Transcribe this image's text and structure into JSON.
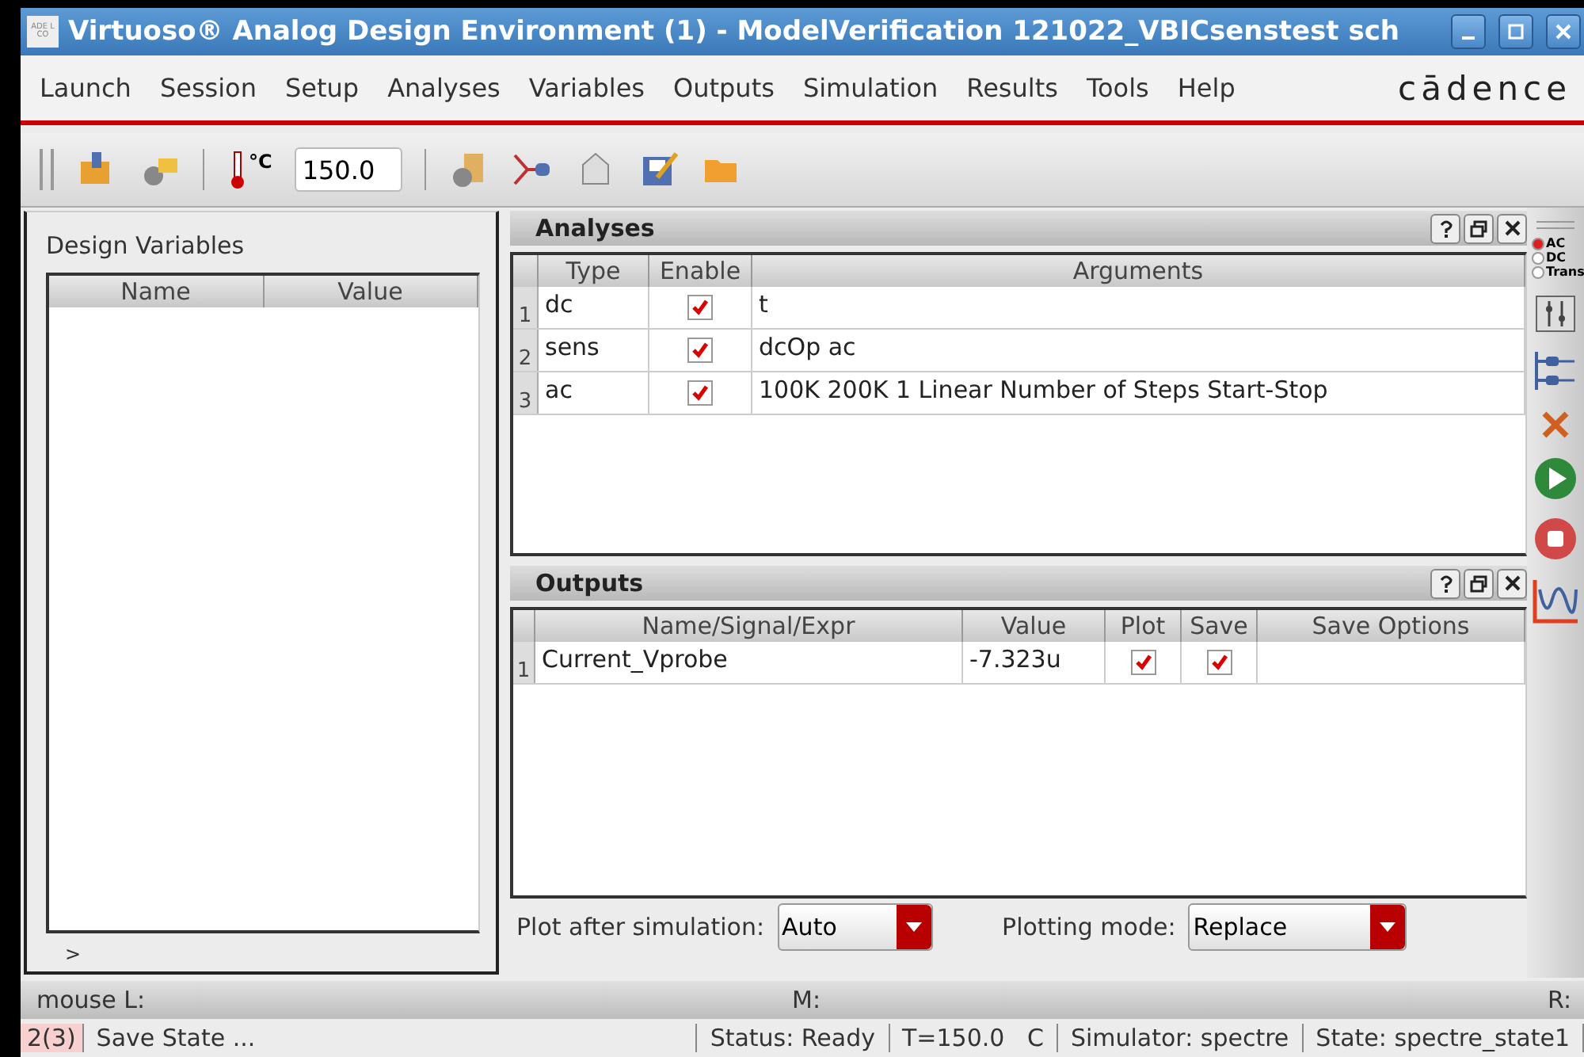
{
  "window": {
    "title": "Virtuoso® Analog Design Environment (1) - ModelVerification 121022_VBICsenstest sch",
    "logo_text": "ADE L CO"
  },
  "menu": [
    "Launch",
    "Session",
    "Setup",
    "Analyses",
    "Variables",
    "Outputs",
    "Simulation",
    "Results",
    "Tools",
    "Help"
  ],
  "brand": "cādence",
  "toolbar": {
    "temperature_unit": "°C",
    "temperature": "150.0"
  },
  "design_variables": {
    "title": "Design Variables",
    "columns": [
      "Name",
      "Value"
    ],
    "prompt": ">"
  },
  "analyses": {
    "title": "Analyses",
    "columns": [
      "Type",
      "Enable",
      "Arguments"
    ],
    "rows": [
      {
        "index": "1",
        "type": "dc",
        "enabled": true,
        "arguments": "t"
      },
      {
        "index": "2",
        "type": "sens",
        "enabled": true,
        "arguments": "dcOp ac"
      },
      {
        "index": "3",
        "type": "ac",
        "enabled": true,
        "arguments": "100K 200K 1 Linear Number of Steps Start-Stop"
      }
    ]
  },
  "outputs": {
    "title": "Outputs",
    "columns": [
      "Name/Signal/Expr",
      "Value",
      "Plot",
      "Save",
      "Save Options"
    ],
    "rows": [
      {
        "index": "1",
        "name": "Current_Vprobe",
        "value": "-7.323u",
        "plot": true,
        "save": true
      }
    ],
    "plot_after_label": "Plot after simulation:",
    "plot_after": "Auto",
    "plotting_mode_label": "Plotting mode:",
    "plotting_mode": "Replace"
  },
  "side_analysis": [
    {
      "label": "AC",
      "selected": true
    },
    {
      "label": "DC",
      "selected": false
    },
    {
      "label": "Trans",
      "selected": false
    }
  ],
  "mouse_bar": {
    "left": "mouse L:",
    "middle": "M:",
    "right": "R:"
  },
  "status_bar": {
    "count": "2(3)",
    "message": "Save State ...",
    "status": "Status: Ready",
    "temp": "T=150.0   C",
    "simulator": "Simulator: spectre",
    "state": "State: spectre_state1"
  }
}
